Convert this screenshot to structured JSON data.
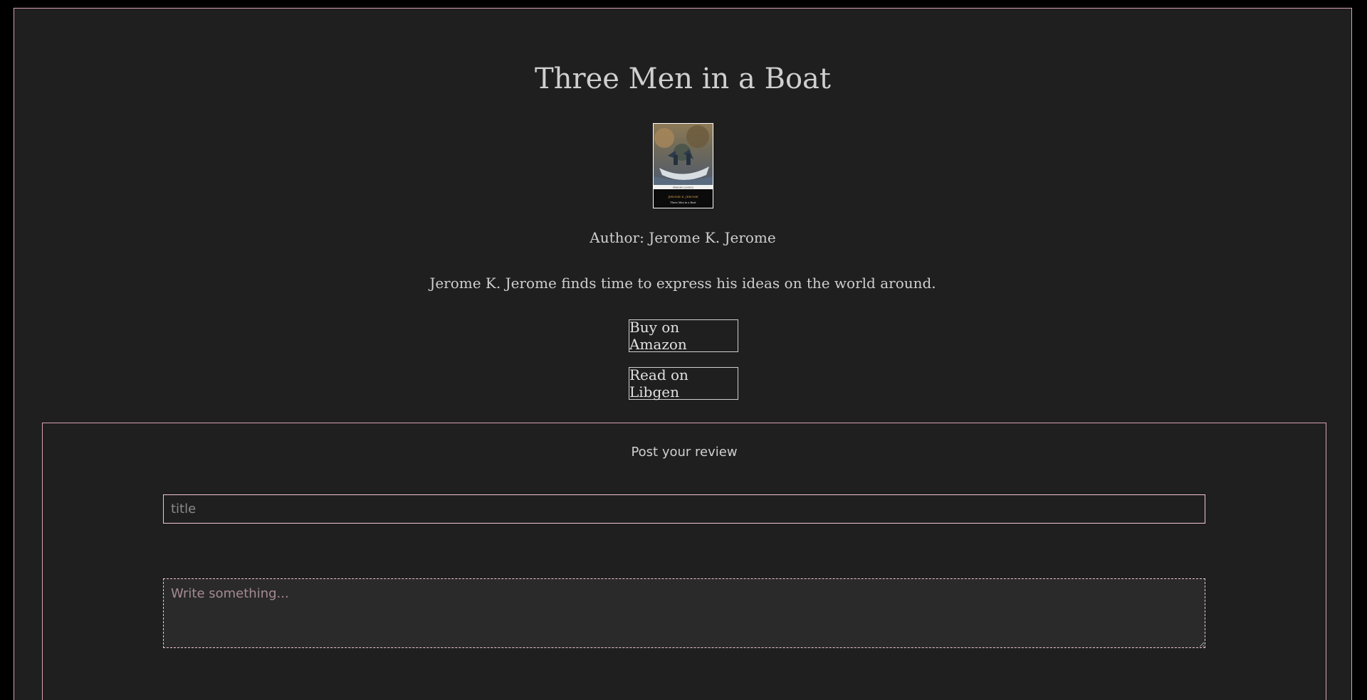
{
  "book": {
    "title": "Three Men in a Boat",
    "cover_alt": "Book cover",
    "cover_author_text": "JEROME K. JEROME",
    "cover_title_text": "Three Men in a Boat",
    "cover_series_text": "PENGUIN CLASSICS",
    "author_line": "Author: Jerome K. Jerome",
    "description": "Jerome K. Jerome finds time to express his ideas on the world around."
  },
  "actions": {
    "buy_label": "Buy on Amazon",
    "read_label": "Read on Libgen"
  },
  "review": {
    "heading": "Post your review",
    "title_placeholder": "title",
    "body_placeholder": "Write something..."
  },
  "colors": {
    "page_background": "#1f1f1f",
    "outer_background": "#000000",
    "accent_border": "#d7a2b3",
    "text": "#cfcfcf"
  }
}
